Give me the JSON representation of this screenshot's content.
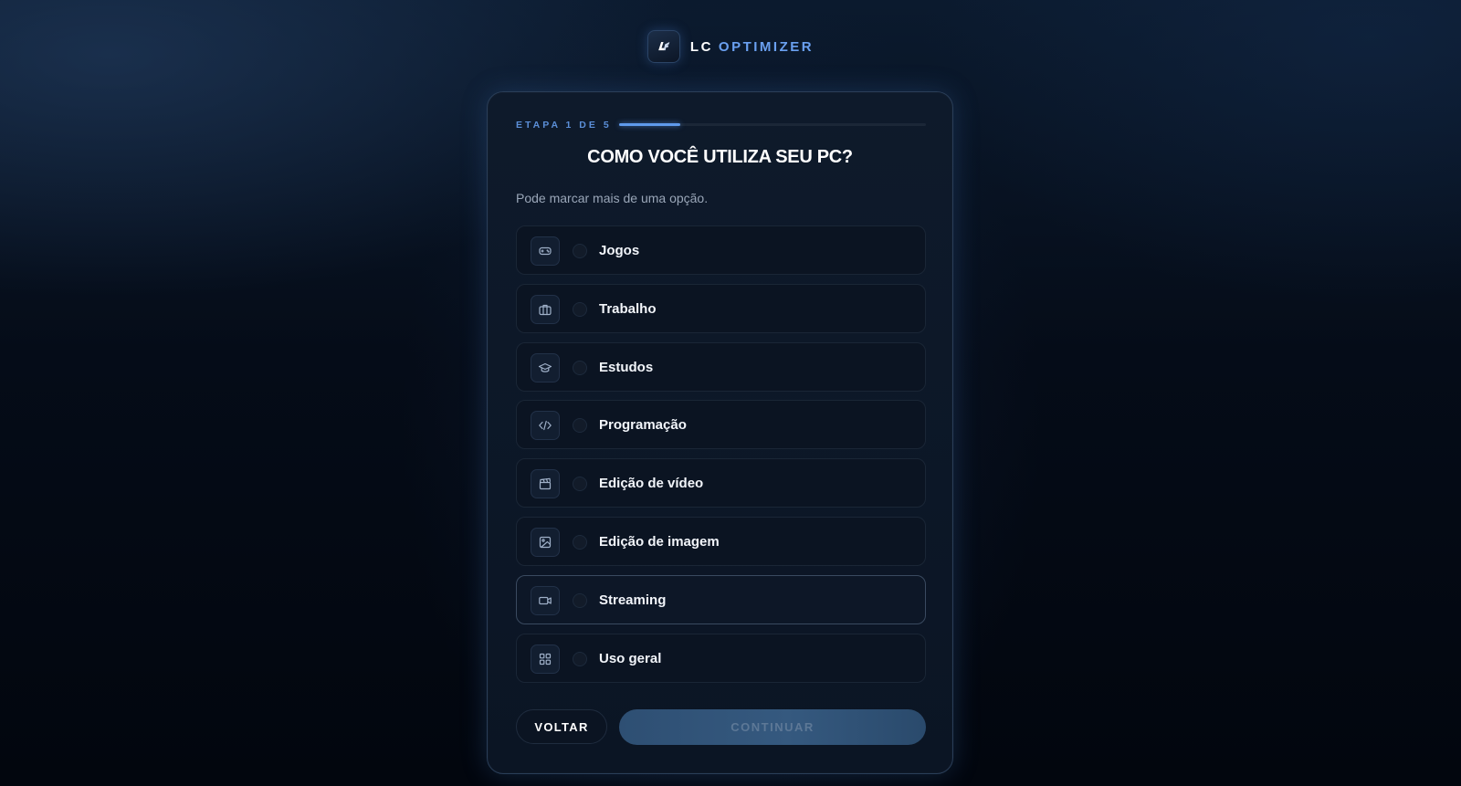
{
  "brand": {
    "prefix": "LC",
    "name": "OPTIMIZER",
    "logo_icon": "lc-logo-icon"
  },
  "step": {
    "label": "ETAPA 1 DE 5",
    "current": 1,
    "total": 5
  },
  "title": "COMO VOCÊ UTILIZA SEU PC?",
  "subtitle": "Pode marcar mais de uma opção.",
  "options": [
    {
      "label": "Jogos",
      "icon": "gamepad-icon",
      "selected": false
    },
    {
      "label": "Trabalho",
      "icon": "briefcase-icon",
      "selected": false
    },
    {
      "label": "Estudos",
      "icon": "graduation-cap-icon",
      "selected": false
    },
    {
      "label": "Programação",
      "icon": "code-icon",
      "selected": false
    },
    {
      "label": "Edição de vídeo",
      "icon": "clapperboard-icon",
      "selected": false
    },
    {
      "label": "Edição de imagem",
      "icon": "image-icon",
      "selected": false
    },
    {
      "label": "Streaming",
      "icon": "video-camera-icon",
      "selected": false,
      "hovered": true
    },
    {
      "label": "Uso geral",
      "icon": "grid-icon",
      "selected": false
    }
  ],
  "buttons": {
    "back": "VOLTAR",
    "continue": "CONTINUAR",
    "continue_enabled": false
  },
  "colors": {
    "accent": "#5f9aec",
    "brand_accent": "#6aa0f0",
    "card_bg": "#0e1a2b",
    "text_muted": "#9aa6b8"
  }
}
